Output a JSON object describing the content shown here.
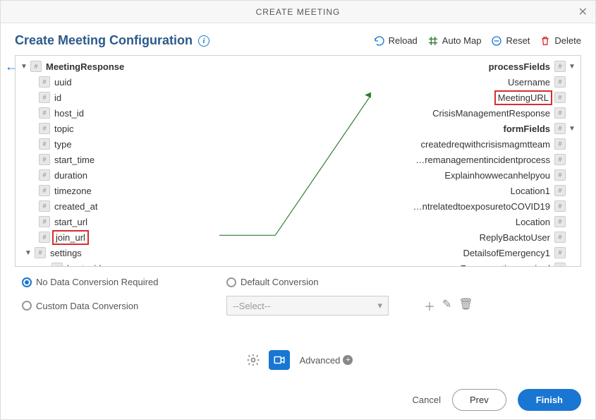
{
  "dialog": {
    "title": "CREATE MEETING",
    "heading": "Create Meeting Configuration"
  },
  "toolbar": {
    "reload": "Reload",
    "automap": "Auto Map",
    "reset": "Reset",
    "delete": "Delete"
  },
  "leftTree": {
    "root": "MeetingResponse",
    "nodes": [
      "uuid",
      "id",
      "host_id",
      "topic",
      "type",
      "start_time",
      "duration",
      "timezone",
      "created_at",
      "start_url",
      "join_url"
    ],
    "settingsNode": "settings",
    "settingsChild": "host_video"
  },
  "rightTree": {
    "processFields": "processFields",
    "username": "Username",
    "meetingURL": "MeetingURL",
    "crisisResp": "CrisisManagementResponse",
    "formFields": "formFields",
    "formItems": [
      "createdreqwithcrisismagmtteam",
      "…remanagementincidentprocess",
      "Explainhowwecanhelpyou",
      "Location1",
      "…ntrelatedtoexposuretoCOVID19",
      "Location",
      "ReplyBacktoUser",
      "DetailsofEmergency1",
      "Zoommeetingrequired"
    ]
  },
  "options": {
    "noConv": "No Data Conversion Required",
    "defaultConv": "Default Conversion",
    "customConv": "Custom Data Conversion",
    "selectPlaceholder": "--Select--"
  },
  "bottom": {
    "advanced": "Advanced"
  },
  "footer": {
    "cancel": "Cancel",
    "prev": "Prev",
    "finish": "Finish"
  }
}
